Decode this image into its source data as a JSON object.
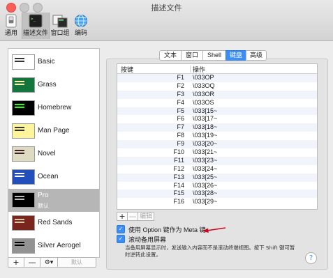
{
  "window": {
    "title": "描述文件"
  },
  "toolbar": [
    {
      "label": "通用",
      "icon": "switch-icon"
    },
    {
      "label": "描述文件",
      "icon": "terminal-icon",
      "selected": true
    },
    {
      "label": "窗口组",
      "icon": "window-group-icon"
    },
    {
      "label": "编码",
      "icon": "globe-icon"
    }
  ],
  "profiles": [
    {
      "name": "Basic",
      "bg": "#ffffff",
      "fg": "#333333"
    },
    {
      "name": "Grass",
      "bg": "#13773d",
      "fg": "#fff0a5"
    },
    {
      "name": "Homebrew",
      "bg": "#000000",
      "fg": "#28fe14"
    },
    {
      "name": "Man Page",
      "bg": "#fef49c",
      "fg": "#333333"
    },
    {
      "name": "Novel",
      "bg": "#dfdbc3",
      "fg": "#3b2322"
    },
    {
      "name": "Ocean",
      "bg": "#224fbc",
      "fg": "#ffffff"
    },
    {
      "name": "Pro",
      "sub": "默认",
      "bg": "#000000",
      "fg": "#bbbbbb",
      "selected": true
    },
    {
      "name": "Red Sands",
      "bg": "#7a251e",
      "fg": "#d7c9a7"
    },
    {
      "name": "Silver Aerogel",
      "bg": "#929292",
      "fg": "#000000"
    }
  ],
  "sidebar_buttons": {
    "add": "+",
    "remove": "—",
    "gear": "⚙▾",
    "default": "默认"
  },
  "tabs": [
    "文本",
    "窗口",
    "Shell",
    "键盘",
    "高级"
  ],
  "active_tab": 3,
  "table": {
    "headers": [
      "按键",
      "操作"
    ],
    "rows": [
      {
        "key": "F1",
        "action": "\\033OP"
      },
      {
        "key": "F2",
        "action": "\\033OQ"
      },
      {
        "key": "F3",
        "action": "\\033OR"
      },
      {
        "key": "F4",
        "action": "\\033OS"
      },
      {
        "key": "F5",
        "action": "\\033[15~"
      },
      {
        "key": "F6",
        "action": "\\033[17~"
      },
      {
        "key": "F7",
        "action": "\\033[18~"
      },
      {
        "key": "F8",
        "action": "\\033[19~"
      },
      {
        "key": "F9",
        "action": "\\033[20~"
      },
      {
        "key": "F10",
        "action": "\\033[21~"
      },
      {
        "key": "F11",
        "action": "\\033[23~"
      },
      {
        "key": "F12",
        "action": "\\033[24~"
      },
      {
        "key": "F13",
        "action": "\\033[25~"
      },
      {
        "key": "F14",
        "action": "\\033[26~"
      },
      {
        "key": "F15",
        "action": "\\033[28~"
      },
      {
        "key": "F16",
        "action": "\\033[29~"
      }
    ]
  },
  "edit_buttons": {
    "add": "+",
    "remove": "—",
    "edit": "编辑"
  },
  "options": {
    "meta_key": {
      "label": "使用 Option 键作为 Meta 键",
      "checked": true
    },
    "alt_screen": {
      "label": "滚动备用屏幕",
      "checked": true
    }
  },
  "help_text": "当备用屏幕显示时，发送输入内容而不是滚动终端视图。按下 Shift 键可暂时逆转此设置。",
  "help_button": "?",
  "colors": {
    "accent": "#3a8ef5",
    "arrow": "#d0021b"
  }
}
